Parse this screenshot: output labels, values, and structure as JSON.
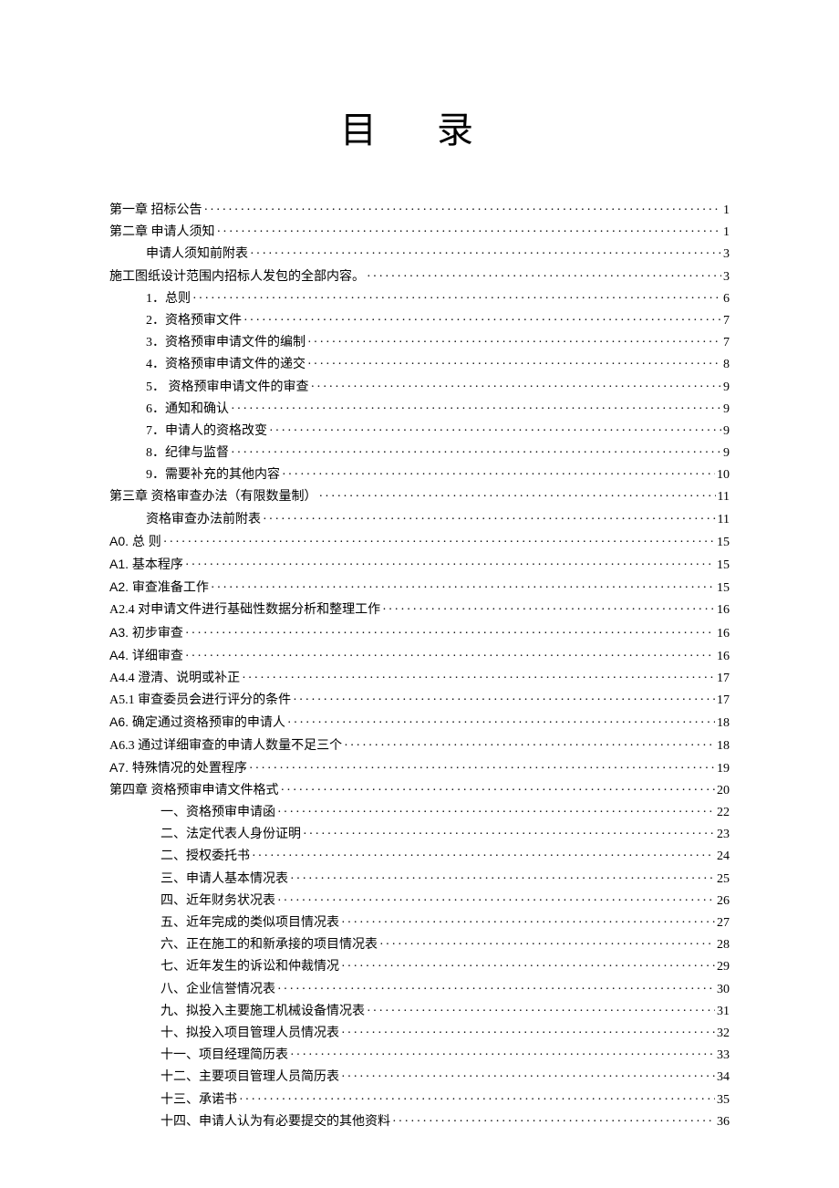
{
  "title": "目  录",
  "entries": [
    {
      "label": "第一章    招标公告",
      "page": "1",
      "indent": 0,
      "bold": false
    },
    {
      "label": "第二章    申请人须知",
      "page": "1",
      "indent": 0,
      "bold": false
    },
    {
      "label": "申请人须知前附表",
      "page": "3",
      "indent": 1,
      "bold": false
    },
    {
      "label": "施工图纸设计范围内招标人发包的全部内容。",
      "page": "3",
      "indent": 0,
      "bold": false
    },
    {
      "label": "1．总则",
      "page": "6",
      "indent": 2,
      "bold": false
    },
    {
      "label": "2．资格预审文件",
      "page": "7",
      "indent": 2,
      "bold": false
    },
    {
      "label": "3．资格预审申请文件的编制",
      "page": "7",
      "indent": 2,
      "bold": false
    },
    {
      "label": "4．资格预审申请文件的递交",
      "page": "8",
      "indent": 2,
      "bold": false
    },
    {
      "label": "5． 资格预审申请文件的审查",
      "page": "9",
      "indent": 2,
      "bold": false
    },
    {
      "label": "6．通知和确认",
      "page": "9",
      "indent": 2,
      "bold": false
    },
    {
      "label": "7．申请人的资格改变",
      "page": "9",
      "indent": 2,
      "bold": false
    },
    {
      "label": "8．纪律与监督",
      "page": "9",
      "indent": 2,
      "bold": false
    },
    {
      "label": "9．需要补充的其他内容",
      "page": "10",
      "indent": 2,
      "bold": false
    },
    {
      "label": "第三章    资格审查办法（有限数量制）",
      "page": "11",
      "indent": 0,
      "bold": false
    },
    {
      "label": "资格审查办法前附表",
      "page": "11",
      "indent": 1,
      "bold": false
    },
    {
      "label": "A0.  总   则",
      "page": "15",
      "indent": 0,
      "bold": true
    },
    {
      "label": "A1.  基本程序",
      "page": "15",
      "indent": 0,
      "bold": true
    },
    {
      "label": "A2.  审查准备工作",
      "page": "15",
      "indent": 0,
      "bold": true
    },
    {
      "label": "A2.4 对申请文件进行基础性数据分析和整理工作",
      "page": "16",
      "indent": 0,
      "bold": false
    },
    {
      "label": "A3.  初步审查",
      "page": "16",
      "indent": 0,
      "bold": true
    },
    {
      "label": "A4.  详细审查",
      "page": "16",
      "indent": 0,
      "bold": true
    },
    {
      "label": "A4.4 澄清、说明或补正",
      "page": "17",
      "indent": 0,
      "bold": false
    },
    {
      "label": "A5.1 审查委员会进行评分的条件",
      "page": "17",
      "indent": 0,
      "bold": false
    },
    {
      "label": "A6.  确定通过资格预审的申请人",
      "page": "18",
      "indent": 0,
      "bold": true
    },
    {
      "label": "A6.3 通过详细审查的申请人数量不足三个",
      "page": "18",
      "indent": 0,
      "bold": false
    },
    {
      "label": "A7.  特殊情况的处置程序",
      "page": "19",
      "indent": 0,
      "bold": true
    },
    {
      "label": "第四章    资格预审申请文件格式",
      "page": "20",
      "indent": 0,
      "bold": false
    },
    {
      "label": "一、资格预审申请函",
      "page": "22",
      "indent": 3,
      "bold": false
    },
    {
      "label": "二、法定代表人身份证明",
      "page": "23",
      "indent": 3,
      "bold": false
    },
    {
      "label": "二、授权委托书",
      "page": "24",
      "indent": 3,
      "bold": false
    },
    {
      "label": "三、申请人基本情况表",
      "page": "25",
      "indent": 3,
      "bold": false
    },
    {
      "label": "四、近年财务状况表",
      "page": "26",
      "indent": 3,
      "bold": false
    },
    {
      "label": "五、近年完成的类似项目情况表",
      "page": "27",
      "indent": 3,
      "bold": false
    },
    {
      "label": "六、正在施工的和新承接的项目情况表",
      "page": "28",
      "indent": 3,
      "bold": false
    },
    {
      "label": "七、近年发生的诉讼和仲裁情况",
      "page": "29",
      "indent": 3,
      "bold": false
    },
    {
      "label": "八、企业信誉情况表",
      "page": "30",
      "indent": 3,
      "bold": false
    },
    {
      "label": "九、拟投入主要施工机械设备情况表",
      "page": "31",
      "indent": 3,
      "bold": false
    },
    {
      "label": "十、拟投入项目管理人员情况表",
      "page": "32",
      "indent": 3,
      "bold": false
    },
    {
      "label": "十一、项目经理简历表",
      "page": "33",
      "indent": 3,
      "bold": false
    },
    {
      "label": "十二、主要项目管理人员简历表",
      "page": "34",
      "indent": 3,
      "bold": false
    },
    {
      "label": "十三、承诺书",
      "page": "35",
      "indent": 3,
      "bold": false
    },
    {
      "label": "十四、申请人认为有必要提交的其他资料",
      "page": "36",
      "indent": 3,
      "bold": false
    }
  ]
}
